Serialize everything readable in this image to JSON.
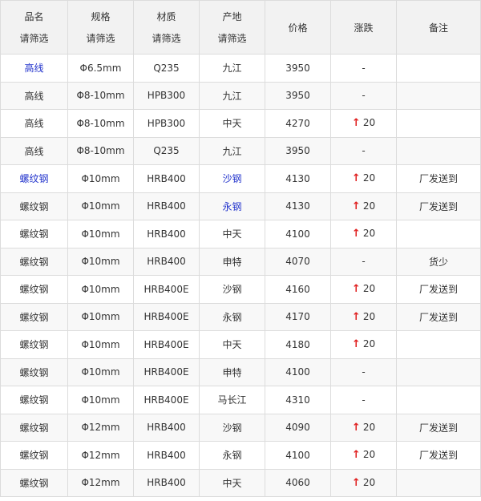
{
  "columns": [
    {
      "label": "品名",
      "filter": "请筛选"
    },
    {
      "label": "规格",
      "filter": "请筛选"
    },
    {
      "label": "材质",
      "filter": "请筛选"
    },
    {
      "label": "产地",
      "filter": "请筛选"
    },
    {
      "label": "价格",
      "filter": ""
    },
    {
      "label": "涨跌",
      "filter": ""
    },
    {
      "label": "备注",
      "filter": ""
    }
  ],
  "arrow_color": "#e02020",
  "link_color": "#2233cc",
  "rows": [
    {
      "name": "高线",
      "spec": "Φ6.5mm",
      "material": "Q235",
      "origin": "九江",
      "price": "3950",
      "change": "-",
      "up": false,
      "note": "",
      "name_link": true,
      "origin_link": false
    },
    {
      "name": "高线",
      "spec": "Φ8-10mm",
      "material": "HPB300",
      "origin": "九江",
      "price": "3950",
      "change": "-",
      "up": false,
      "note": "",
      "name_link": false,
      "origin_link": false
    },
    {
      "name": "高线",
      "spec": "Φ8-10mm",
      "material": "HPB300",
      "origin": "中天",
      "price": "4270",
      "change": "20",
      "up": true,
      "note": "",
      "name_link": false,
      "origin_link": false
    },
    {
      "name": "高线",
      "spec": "Φ8-10mm",
      "material": "Q235",
      "origin": "九江",
      "price": "3950",
      "change": "-",
      "up": false,
      "note": "",
      "name_link": false,
      "origin_link": false
    },
    {
      "name": "螺纹钢",
      "spec": "Φ10mm",
      "material": "HRB400",
      "origin": "沙钢",
      "price": "4130",
      "change": "20",
      "up": true,
      "note": "厂发送到",
      "name_link": true,
      "origin_link": true
    },
    {
      "name": "螺纹钢",
      "spec": "Φ10mm",
      "material": "HRB400",
      "origin": "永钢",
      "price": "4130",
      "change": "20",
      "up": true,
      "note": "厂发送到",
      "name_link": false,
      "origin_link": true
    },
    {
      "name": "螺纹钢",
      "spec": "Φ10mm",
      "material": "HRB400",
      "origin": "中天",
      "price": "4100",
      "change": "20",
      "up": true,
      "note": "",
      "name_link": false,
      "origin_link": false
    },
    {
      "name": "螺纹钢",
      "spec": "Φ10mm",
      "material": "HRB400",
      "origin": "申特",
      "price": "4070",
      "change": "-",
      "up": false,
      "note": "货少",
      "name_link": false,
      "origin_link": false
    },
    {
      "name": "螺纹钢",
      "spec": "Φ10mm",
      "material": "HRB400E",
      "origin": "沙钢",
      "price": "4160",
      "change": "20",
      "up": true,
      "note": "厂发送到",
      "name_link": false,
      "origin_link": false
    },
    {
      "name": "螺纹钢",
      "spec": "Φ10mm",
      "material": "HRB400E",
      "origin": "永钢",
      "price": "4170",
      "change": "20",
      "up": true,
      "note": "厂发送到",
      "name_link": false,
      "origin_link": false
    },
    {
      "name": "螺纹钢",
      "spec": "Φ10mm",
      "material": "HRB400E",
      "origin": "中天",
      "price": "4180",
      "change": "20",
      "up": true,
      "note": "",
      "name_link": false,
      "origin_link": false
    },
    {
      "name": "螺纹钢",
      "spec": "Φ10mm",
      "material": "HRB400E",
      "origin": "申特",
      "price": "4100",
      "change": "-",
      "up": false,
      "note": "",
      "name_link": false,
      "origin_link": false
    },
    {
      "name": "螺纹钢",
      "spec": "Φ10mm",
      "material": "HRB400E",
      "origin": "马长江",
      "price": "4310",
      "change": "-",
      "up": false,
      "note": "",
      "name_link": false,
      "origin_link": false
    },
    {
      "name": "螺纹钢",
      "spec": "Φ12mm",
      "material": "HRB400",
      "origin": "沙钢",
      "price": "4090",
      "change": "20",
      "up": true,
      "note": "厂发送到",
      "name_link": false,
      "origin_link": false
    },
    {
      "name": "螺纹钢",
      "spec": "Φ12mm",
      "material": "HRB400",
      "origin": "永钢",
      "price": "4100",
      "change": "20",
      "up": true,
      "note": "厂发送到",
      "name_link": false,
      "origin_link": false
    },
    {
      "name": "螺纹钢",
      "spec": "Φ12mm",
      "material": "HRB400",
      "origin": "中天",
      "price": "4060",
      "change": "20",
      "up": true,
      "note": "",
      "name_link": false,
      "origin_link": false
    }
  ]
}
